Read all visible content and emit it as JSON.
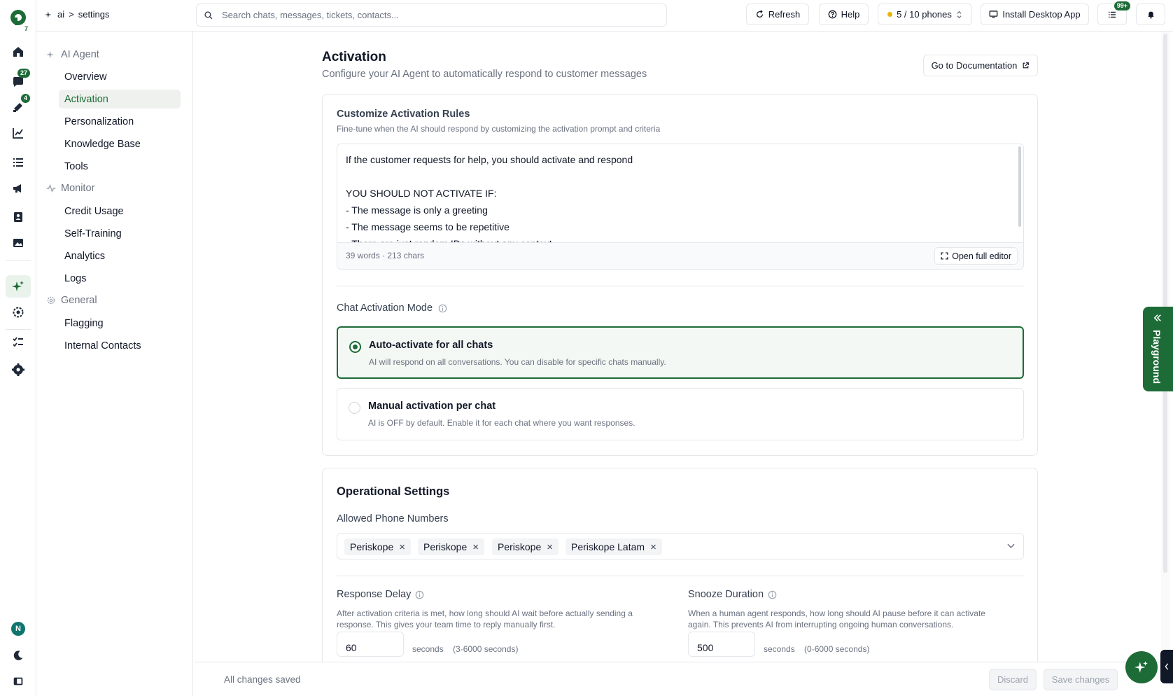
{
  "breadcrumb": {
    "root": "ai",
    "separator": ">",
    "current": "settings"
  },
  "search": {
    "placeholder": "Search chats, messages, tickets, contacts..."
  },
  "topbar": {
    "refresh": "Refresh",
    "help": "Help",
    "phones": "5 / 10 phones",
    "install": "Install Desktop App",
    "list_badge": "99+"
  },
  "rail": {
    "chats_badge": "27",
    "tickets_badge": "4",
    "avatar_initial": "N",
    "logo_badge": "7"
  },
  "sidebar": {
    "sections": [
      {
        "label": "AI Agent",
        "items": [
          "Overview",
          "Activation",
          "Personalization",
          "Knowledge Base",
          "Tools"
        ]
      },
      {
        "label": "Monitor",
        "items": [
          "Credit Usage",
          "Self-Training",
          "Analytics",
          "Logs"
        ]
      },
      {
        "label": "General",
        "items": [
          "Flagging",
          "Internal Contacts"
        ]
      }
    ],
    "active_item": "Activation"
  },
  "page": {
    "title": "Activation",
    "subtitle": "Configure your AI Agent to automatically respond to customer messages",
    "doc_button": "Go to Documentation"
  },
  "activation_rules": {
    "title": "Customize Activation Rules",
    "hint": "Fine-tune when the AI should respond by customizing the activation prompt and criteria",
    "lines": [
      "If the customer requests for help, you should activate and respond",
      "",
      "YOU SHOULD NOT ACTIVATE IF:",
      "- The message is only a greeting",
      "- The message seems to be repetitive",
      "- There are just random IDs without any context"
    ],
    "word_count": "39 words · 213 chars",
    "open_editor": "Open full editor"
  },
  "chat_mode": {
    "title": "Chat Activation Mode",
    "options": [
      {
        "title": "Auto-activate for all chats",
        "desc": "AI will respond on all conversations. You can disable for specific chats manually.",
        "selected": true
      },
      {
        "title": "Manual activation per chat",
        "desc": "AI is OFF by default. Enable it for each chat where you want responses.",
        "selected": false
      }
    ]
  },
  "operational": {
    "title": "Operational Settings",
    "phones_label": "Allowed Phone Numbers",
    "phones": [
      "Periskope",
      "Periskope",
      "Periskope",
      "Periskope Latam"
    ],
    "response_delay": {
      "label": "Response Delay",
      "desc_line1": "After activation criteria is met, how long should AI wait before actually sending a",
      "desc_line2": "response. This gives your team time to reply manually first.",
      "value": "60",
      "unit": "seconds",
      "range": "(3-6000 seconds)"
    },
    "snooze": {
      "label": "Snooze Duration",
      "desc_line1": "When a human agent responds, how long should AI pause before it can activate",
      "desc_line2": "again. This prevents AI from interrupting ongoing human conversations.",
      "value": "500",
      "unit": "seconds",
      "range": "(0-6000 seconds)"
    }
  },
  "footer": {
    "status": "All changes saved",
    "discard": "Discard",
    "save": "Save changes"
  },
  "playground": {
    "label": "Playground"
  },
  "colors": {
    "brand": "#1d6b37",
    "text": "#111827",
    "muted": "#6b7280",
    "border": "#e5e7eb"
  }
}
